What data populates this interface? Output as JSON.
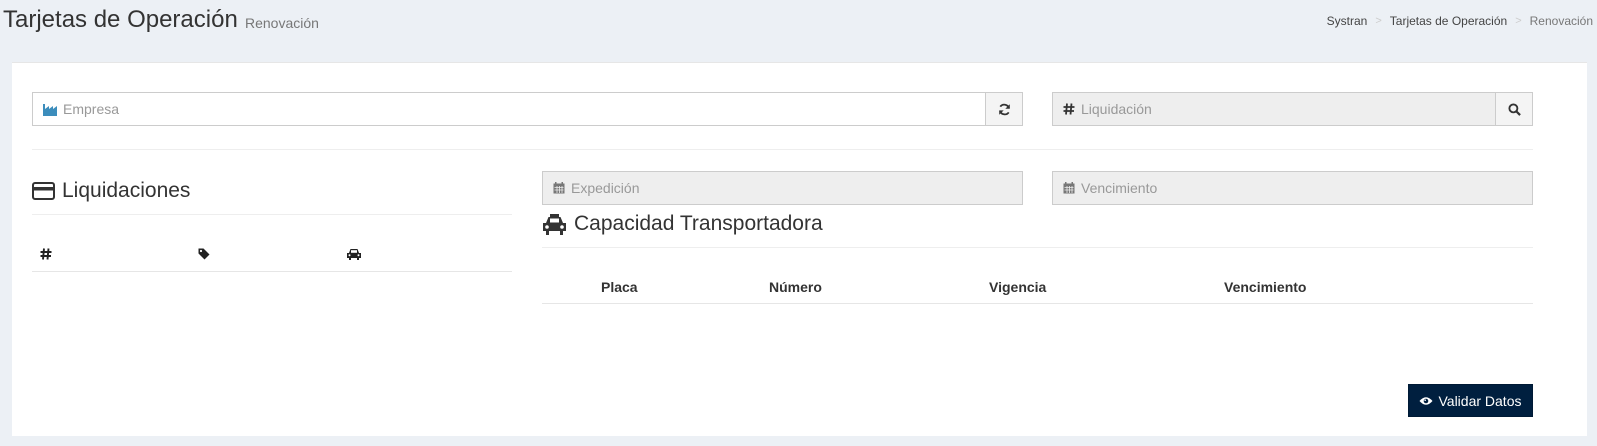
{
  "header": {
    "title": "Tarjetas de Operación",
    "subtitle": "Renovación",
    "breadcrumb": [
      "Systran",
      "Tarjetas de Operación",
      "Renovación"
    ],
    "breadcrumb_separator": ">"
  },
  "form": {
    "empresa": {
      "placeholder": "Empresa",
      "value": "",
      "icon": "industry-icon",
      "button_icon": "refresh-icon"
    },
    "liquidacion": {
      "placeholder": "Liquidación",
      "value": "",
      "icon": "hashtag-icon",
      "button_icon": "search-icon"
    },
    "expedicion": {
      "placeholder": "Expedición",
      "value": "",
      "icon": "calendar-icon"
    },
    "vencimiento": {
      "placeholder": "Vencimiento",
      "value": "",
      "icon": "calendar-icon"
    }
  },
  "liquidaciones": {
    "title": "Liquidaciones",
    "icon": "credit-card-icon",
    "columns": [
      {
        "icon": "hashtag-icon",
        "text": "#"
      },
      {
        "icon": "tag-icon"
      },
      {
        "icon": "car-icon"
      }
    ],
    "rows": []
  },
  "capacidad": {
    "title": "Capacidad Transportadora",
    "icon": "taxi-icon",
    "columns": [
      "Placa",
      "Número",
      "Vigencia",
      "Vencimiento"
    ],
    "rows": []
  },
  "actions": {
    "validar_label": "Validar Datos",
    "validar_icon": "eye-icon"
  },
  "colors": {
    "background": "#ecf0f5",
    "button_primary": "#001f3f",
    "empresa_icon": "#3c8dbc"
  }
}
